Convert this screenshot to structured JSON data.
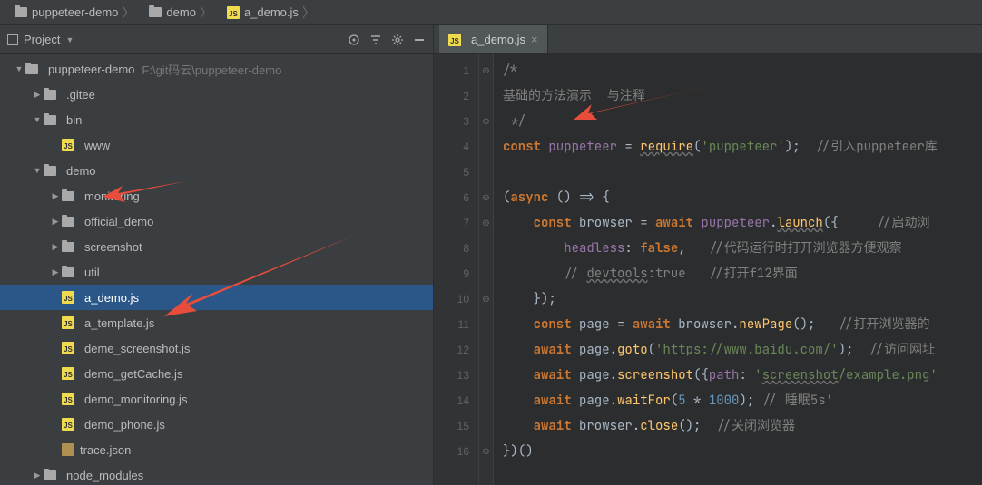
{
  "breadcrumbs": [
    {
      "icon": "folder",
      "label": "puppeteer-demo"
    },
    {
      "icon": "folder",
      "label": "demo"
    },
    {
      "icon": "js",
      "label": "a_demo.js"
    }
  ],
  "project_panel": {
    "title": "Project",
    "tools": [
      "target-icon",
      "filter-icon",
      "gear-icon",
      "collapse-icon"
    ],
    "tree": [
      {
        "level": 0,
        "arrow": "down",
        "icon": "folder",
        "label": "puppeteer-demo",
        "path": "F:\\git码云\\puppeteer-demo"
      },
      {
        "level": 1,
        "arrow": "right",
        "icon": "folder",
        "label": ".gitee"
      },
      {
        "level": 1,
        "arrow": "down",
        "icon": "folder",
        "label": "bin"
      },
      {
        "level": 2,
        "arrow": "",
        "icon": "js",
        "label": "www"
      },
      {
        "level": 1,
        "arrow": "down",
        "icon": "folder",
        "label": "demo",
        "annot": true
      },
      {
        "level": 2,
        "arrow": "right",
        "icon": "folder",
        "label": "monitoring"
      },
      {
        "level": 2,
        "arrow": "right",
        "icon": "folder",
        "label": "official_demo"
      },
      {
        "level": 2,
        "arrow": "right",
        "icon": "folder",
        "label": "screenshot"
      },
      {
        "level": 2,
        "arrow": "right",
        "icon": "folder",
        "label": "util"
      },
      {
        "level": 2,
        "arrow": "",
        "icon": "js",
        "label": "a_demo.js",
        "selected": true,
        "annot": true
      },
      {
        "level": 2,
        "arrow": "",
        "icon": "js",
        "label": "a_template.js"
      },
      {
        "level": 2,
        "arrow": "",
        "icon": "js",
        "label": "deme_screenshot.js"
      },
      {
        "level": 2,
        "arrow": "",
        "icon": "js",
        "label": "demo_getCache.js"
      },
      {
        "level": 2,
        "arrow": "",
        "icon": "js",
        "label": "demo_monitoring.js"
      },
      {
        "level": 2,
        "arrow": "",
        "icon": "js",
        "label": "demo_phone.js"
      },
      {
        "level": 2,
        "arrow": "",
        "icon": "json",
        "label": "trace.json"
      },
      {
        "level": 1,
        "arrow": "right",
        "icon": "folder",
        "label": "node_modules"
      }
    ]
  },
  "editor_tab": {
    "icon": "js",
    "label": "a_demo.js"
  },
  "code": {
    "line_count": 16,
    "lines": [
      {
        "n": 1,
        "fold": "⊖",
        "html": "<span class=\"c-cmt\">/*</span>"
      },
      {
        "n": 2,
        "fold": "",
        "html": "<span class=\"c-cmt\">基础的方法演示  与注释</span>"
      },
      {
        "n": 3,
        "fold": "⊖",
        "html": " <span class=\"c-cmt\">*/</span>"
      },
      {
        "n": 4,
        "fold": "",
        "html": "<span class=\"c-kw\">const</span> <span class=\"c-id\">puppeteer</span> = <span class=\"c-fn c-under\">require</span>(<span class=\"c-str\">'puppeteer'</span>);  <span class=\"c-cmt\">//引入puppeteer库</span>"
      },
      {
        "n": 5,
        "fold": "",
        "html": ""
      },
      {
        "n": 6,
        "fold": "⊖",
        "html": "(<span class=\"c-kw\">async</span> () =&gt; {"
      },
      {
        "n": 7,
        "fold": "⊖",
        "html": "    <span class=\"c-kw\">const</span> browser = <span class=\"c-kw\">await</span> <span class=\"c-id\">puppeteer</span>.<span class=\"c-fn c-under\">launch</span>({     <span class=\"c-cmt\">//启动浏</span>"
      },
      {
        "n": 8,
        "fold": "",
        "html": "        <span class=\"c-id\">headless</span>: <span class=\"c-bool\">false</span>,   <span class=\"c-cmt\">//代码运行时打开浏览器方便观察</span>"
      },
      {
        "n": 9,
        "fold": "",
        "html": "        <span class=\"c-cmt\">// <span class=\"c-under\">devtools</span>:true   //打开f12界面</span>"
      },
      {
        "n": 10,
        "fold": "⊖",
        "html": "    });"
      },
      {
        "n": 11,
        "fold": "",
        "html": "    <span class=\"c-kw\">const</span> page = <span class=\"c-kw\">await</span> browser.<span class=\"c-fn\">newPage</span>();   <span class=\"c-cmt\">//打开浏览器的</span>"
      },
      {
        "n": 12,
        "fold": "",
        "html": "    <span class=\"c-kw\">await</span> page.<span class=\"c-fn\">goto</span>(<span class=\"c-str\">'https://www.baidu.com/'</span>);  <span class=\"c-cmt\">//访问网址</span>"
      },
      {
        "n": 13,
        "fold": "",
        "html": "    <span class=\"c-kw\">await</span> page.<span class=\"c-fn\">screenshot</span>({<span class=\"c-id\">path</span>: <span class=\"c-str\">'<span class=\"c-under\">screenshot</span>/example.png'</span>"
      },
      {
        "n": 14,
        "fold": "",
        "html": "    <span class=\"c-kw\">await</span> page.<span class=\"c-fn\">waitFor</span>(<span class=\"c-num\">5</span> * <span class=\"c-num\">1000</span>); <span class=\"c-cmt\">// 睡眠5s'</span>"
      },
      {
        "n": 15,
        "fold": "",
        "html": "    <span class=\"c-kw\">await</span> browser.<span class=\"c-fn\">close</span>();  <span class=\"c-cmt\">//关闭浏览器</span>"
      },
      {
        "n": 16,
        "fold": "⊖",
        "html": "})()"
      }
    ]
  }
}
